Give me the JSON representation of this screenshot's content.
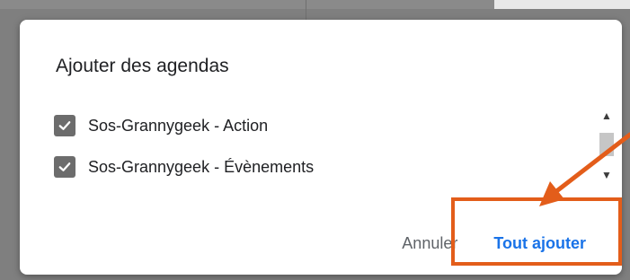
{
  "dialog": {
    "title": "Ajouter des agendas",
    "items": [
      {
        "label": "Sos-Grannygeek - Action",
        "checked": true
      },
      {
        "label": "Sos-Grannygeek - Évènements",
        "checked": true
      }
    ],
    "cancel_label": "Annuler",
    "add_all_label": "Tout ajouter"
  },
  "scrollbar": {
    "up_icon": "chevron-up-icon",
    "down_icon": "chevron-down-icon"
  },
  "annotation": {
    "color": "#e35d1a"
  },
  "colors": {
    "accent": "#1a73e8",
    "checkbox": "#6c6c6c"
  }
}
